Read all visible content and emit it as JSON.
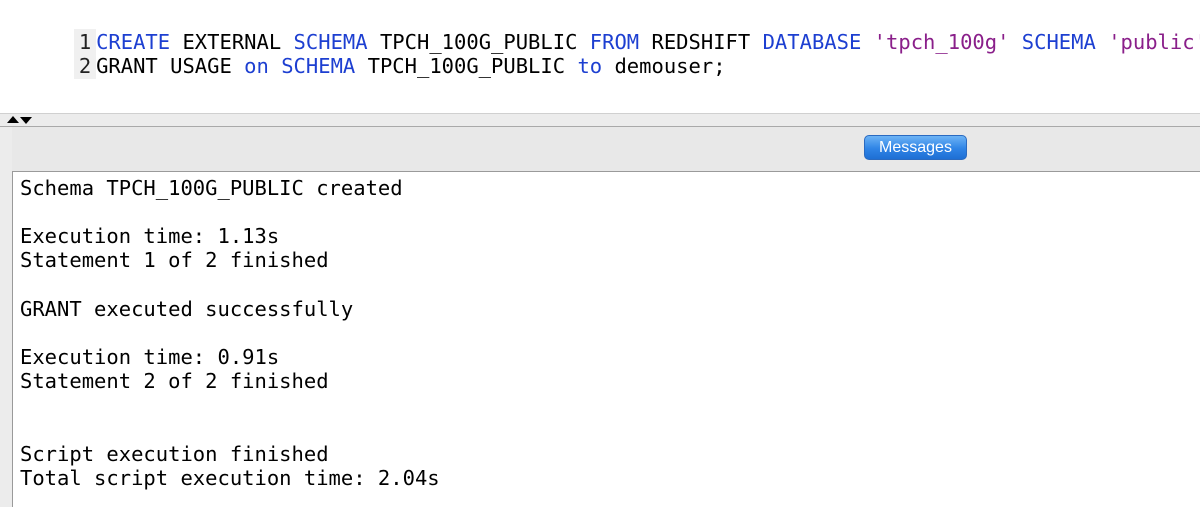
{
  "editor": {
    "lines": [
      {
        "number": "1",
        "tokens": [
          {
            "text": "CREATE",
            "kind": "keyword"
          },
          {
            "text": " EXTERNAL ",
            "kind": "plain"
          },
          {
            "text": "SCHEMA",
            "kind": "keyword"
          },
          {
            "text": " TPCH_100G_PUBLIC ",
            "kind": "plain"
          },
          {
            "text": "FROM",
            "kind": "keyword"
          },
          {
            "text": " REDSHIFT ",
            "kind": "plain"
          },
          {
            "text": "DATABASE",
            "kind": "keyword"
          },
          {
            "text": " ",
            "kind": "plain"
          },
          {
            "text": "'tpch_100g'",
            "kind": "string"
          },
          {
            "text": " ",
            "kind": "plain"
          },
          {
            "text": "SCHEMA",
            "kind": "keyword"
          },
          {
            "text": " ",
            "kind": "plain"
          },
          {
            "text": "'public'",
            "kind": "string"
          },
          {
            "text": ";",
            "kind": "plain"
          }
        ]
      },
      {
        "number": "2",
        "tokens": [
          {
            "text": "GRANT USAGE ",
            "kind": "plain"
          },
          {
            "text": "on",
            "kind": "keyword"
          },
          {
            "text": " ",
            "kind": "plain"
          },
          {
            "text": "SCHEMA",
            "kind": "keyword"
          },
          {
            "text": " TPCH_100G_PUBLIC ",
            "kind": "plain"
          },
          {
            "text": "to",
            "kind": "keyword"
          },
          {
            "text": " demouser;",
            "kind": "plain"
          }
        ]
      }
    ]
  },
  "splitter": {
    "up_icon": "triangle-up-icon",
    "down_icon": "triangle-down-icon"
  },
  "results": {
    "tab_label": "Messages",
    "messages": [
      "Schema TPCH_100G_PUBLIC created",
      "",
      "Execution time: 1.13s",
      "Statement 1 of 2 finished",
      "",
      "GRANT executed successfully",
      "",
      "Execution time: 0.91s",
      "Statement 2 of 2 finished",
      "",
      "",
      "Script execution finished",
      "Total script execution time: 2.04s"
    ]
  },
  "colors": {
    "keyword": "#1d3fd1",
    "string": "#8a1f8a",
    "plain": "#000000",
    "tab_active": "#2f84e6"
  }
}
